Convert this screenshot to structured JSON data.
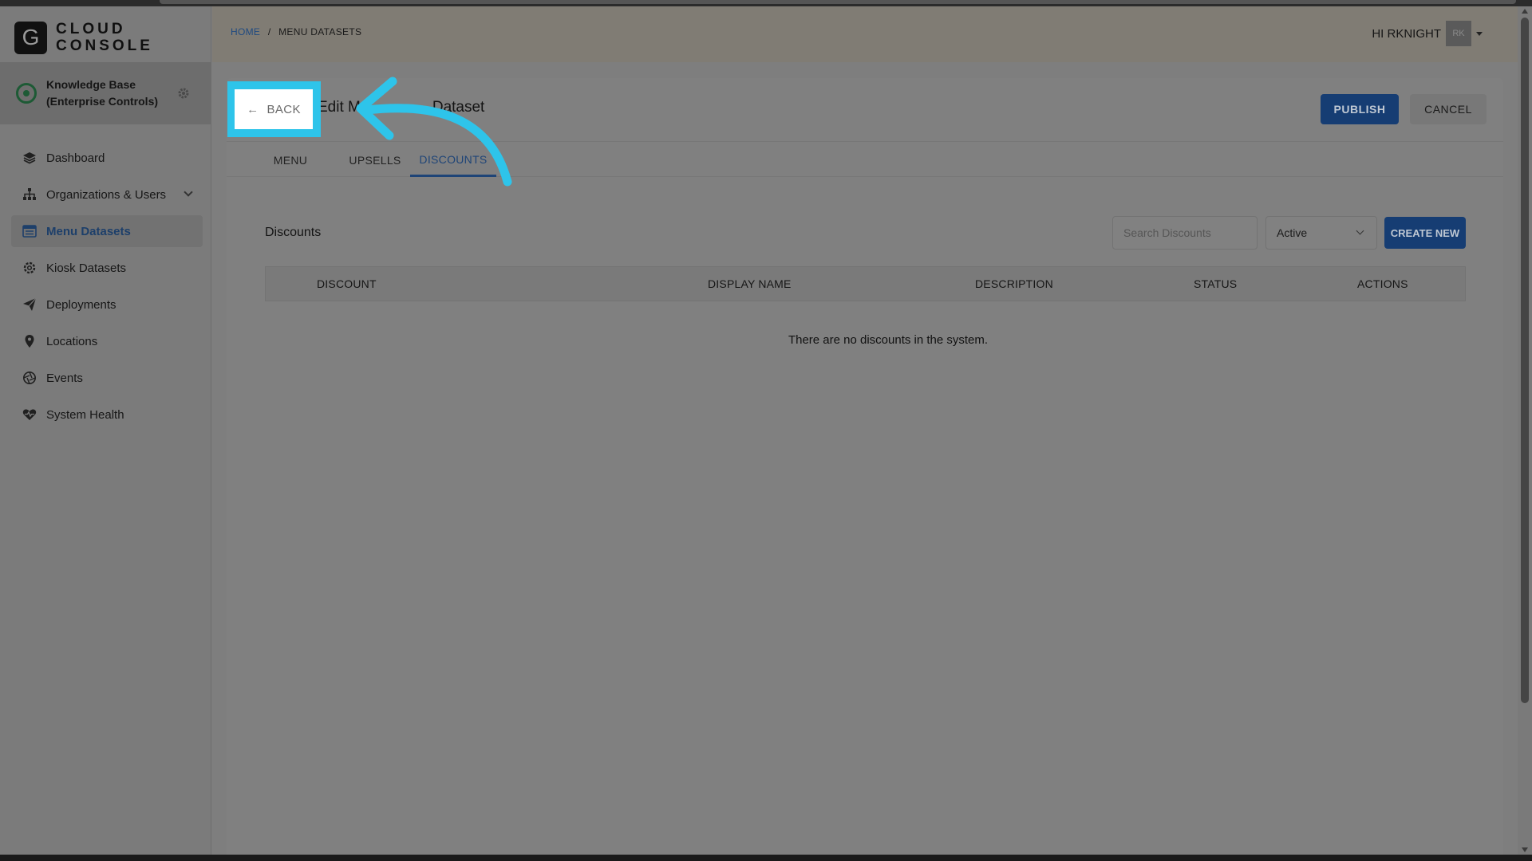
{
  "app": {
    "logo_letter": "G",
    "logo_line1": "CLOUD",
    "logo_line2": "CONSOLE"
  },
  "org": {
    "name": "Knowledge Base (Enterprise Controls)"
  },
  "sidebar": {
    "items": [
      {
        "label": "Dashboard",
        "icon": "layers-icon"
      },
      {
        "label": "Organizations & Users",
        "icon": "org-chart-icon"
      },
      {
        "label": "Menu Datasets",
        "icon": "menu-list-icon"
      },
      {
        "label": "Kiosk Datasets",
        "icon": "gear-icon"
      },
      {
        "label": "Deployments",
        "icon": "paper-plane-icon"
      },
      {
        "label": "Locations",
        "icon": "map-pin-icon"
      },
      {
        "label": "Events",
        "icon": "aperture-icon"
      },
      {
        "label": "System Health",
        "icon": "heartbeat-icon"
      }
    ],
    "active_item": "Menu Datasets"
  },
  "header": {
    "breadcrumb_home": "HOME",
    "breadcrumb_sep": "/",
    "breadcrumb_current": "MENU DATASETS",
    "greeting": "HI RKNIGHT",
    "avatar_initials": "RK"
  },
  "page": {
    "title_left": "Edit M",
    "title_right": "Dataset",
    "back_label": "BACK",
    "publish_label": "PUBLISH",
    "cancel_label": "CANCEL",
    "tabs": [
      "MENU",
      "UPSELLS",
      "DISCOUNTS"
    ],
    "active_tab": "DISCOUNTS"
  },
  "discounts": {
    "section_title": "Discounts",
    "search_placeholder": "Search Discounts",
    "status_filter": "Active",
    "create_label": "CREATE NEW",
    "columns": [
      "DISCOUNT",
      "DISPLAY NAME",
      "DESCRIPTION",
      "STATUS",
      "ACTIONS"
    ],
    "empty_message": "There are no discounts in the system."
  },
  "colors": {
    "primary": "#163d73",
    "highlight": "#2ec4ea",
    "active_tab": "#1e4477"
  }
}
